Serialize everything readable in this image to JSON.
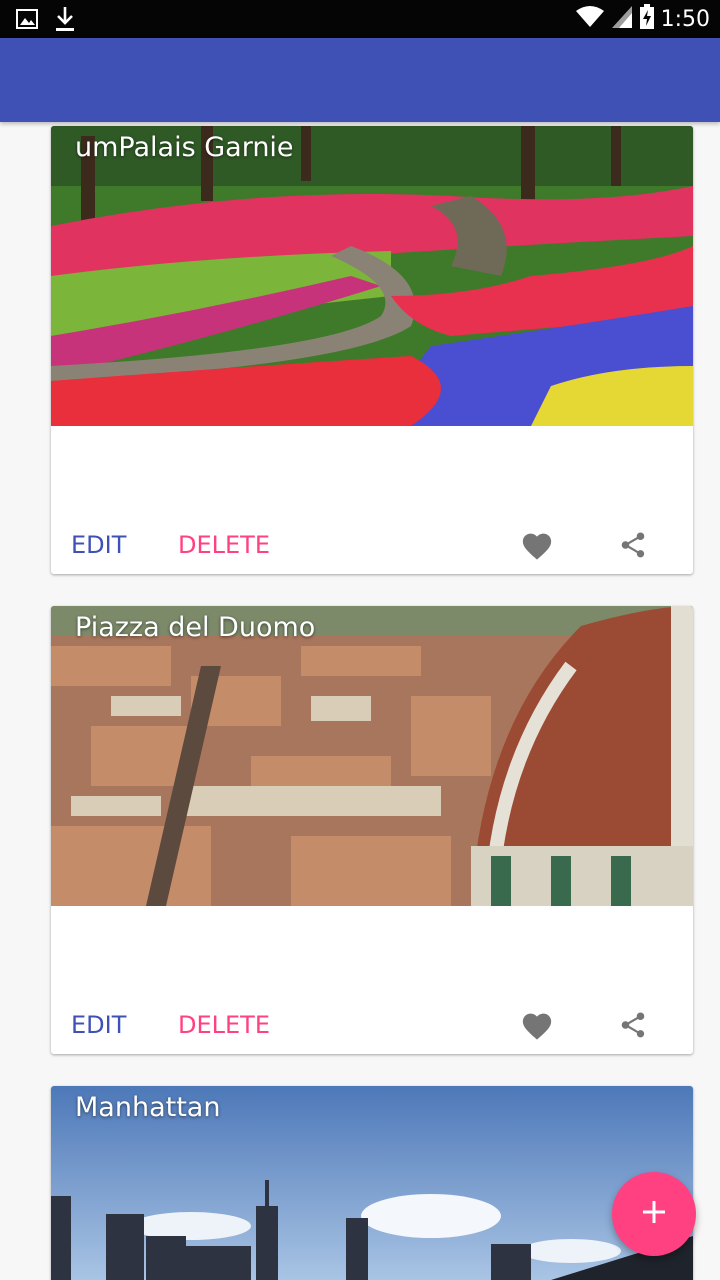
{
  "status_bar": {
    "time": "1:50",
    "icons": [
      "image-icon",
      "download-icon",
      "wifi-icon",
      "signal-icon",
      "battery-charging-icon"
    ]
  },
  "app_bar": {
    "title": ""
  },
  "cards": [
    {
      "title": "umPalais Garnie",
      "image": "tulip-garden-photo",
      "edit_label": "EDIT",
      "delete_label": "DELETE",
      "icons": [
        "favorite-icon",
        "share-icon"
      ]
    },
    {
      "title": "Piazza del Duomo",
      "image": "florence-rooftops-photo",
      "edit_label": "EDIT",
      "delete_label": "DELETE",
      "icons": [
        "favorite-icon",
        "share-icon"
      ]
    },
    {
      "title": "Manhattan",
      "image": "manhattan-skyline-photo"
    }
  ],
  "fab": {
    "icon": "add-icon"
  },
  "colors": {
    "primary": "#3f51b5",
    "accent": "#ff4081",
    "status_bar": "#050505",
    "background": "#f7f7f7",
    "icon_gray": "#757575"
  }
}
